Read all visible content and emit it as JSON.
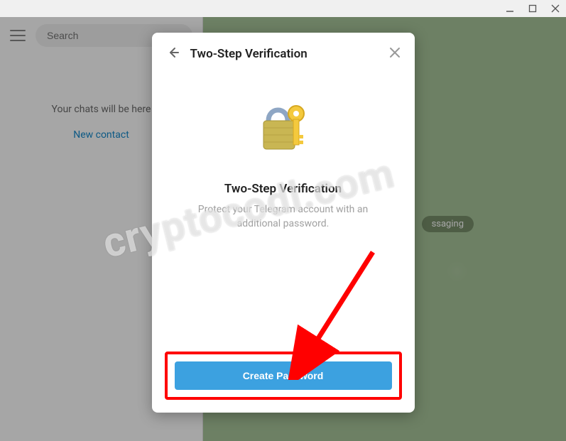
{
  "titlebar": {
    "min_tooltip": "Minimize",
    "max_tooltip": "Maximize",
    "close_tooltip": "Close"
  },
  "sidebar": {
    "search_placeholder": "Search",
    "chats_empty": "Your chats will be here",
    "new_contact": "New contact"
  },
  "chat": {
    "badge_text": "ssaging"
  },
  "modal": {
    "header_title": "Two-Step Verification",
    "body_title": "Two-Step Verification",
    "body_desc": "Protect your Telegram account with an additional password.",
    "create_btn": "Create Password"
  },
  "watermark": "cryptocodl.com"
}
